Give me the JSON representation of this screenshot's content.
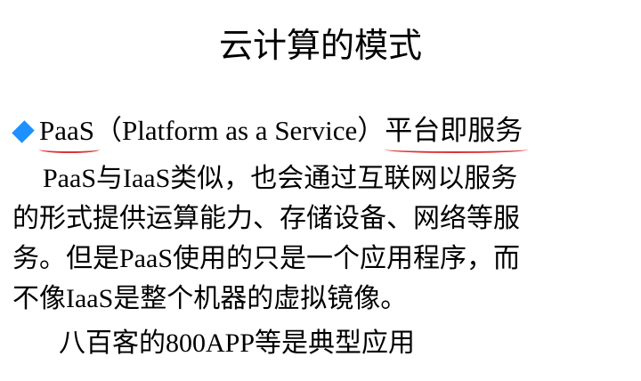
{
  "slide": {
    "title": "云计算的模式",
    "bullet": {
      "icon": "diamond-bullet-icon",
      "color": "#1e90ff",
      "term": "PaaS",
      "expansion": "（Platform as a Service）",
      "meaning": "平台即服务"
    },
    "paragraph_lines": [
      "PaaS与IaaS类似，也会通过互联网以服务",
      "的形式提供运算能力、存储设备、网络等服",
      "务。但是PaaS使用的只是一个应用程序，而",
      "不像IaaS是整个机器的虚拟镜像。"
    ],
    "example": "八百客的800APP等是典型应用"
  }
}
